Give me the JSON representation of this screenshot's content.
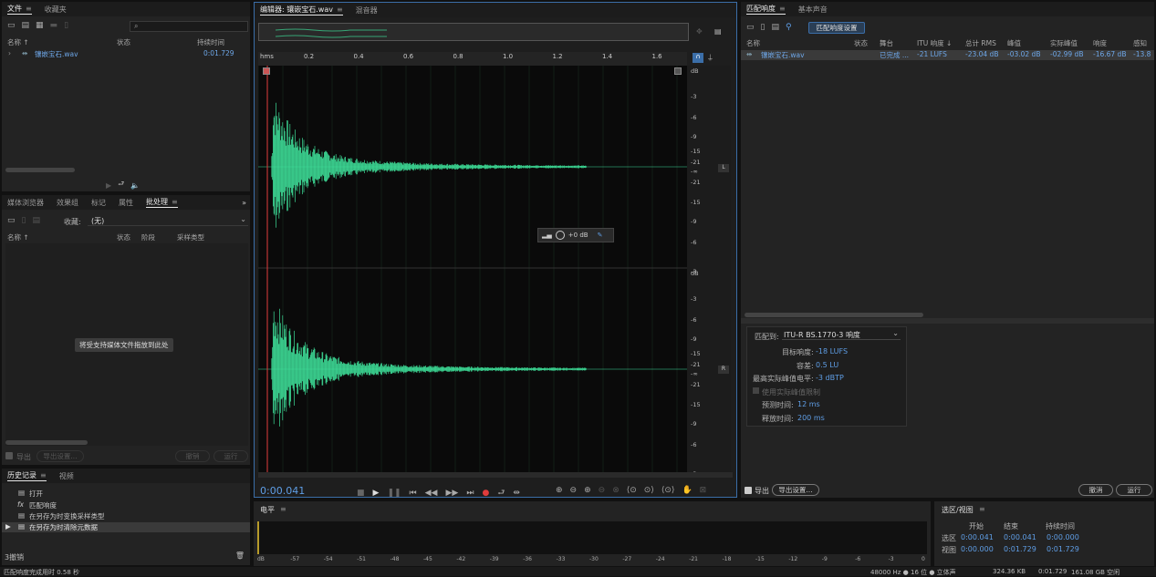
{
  "files_panel": {
    "tabs": [
      "文件",
      "收藏夹"
    ],
    "search_icon": "⌕",
    "col_name": "名称 ↑",
    "col_status": "状态",
    "col_duration": "持续时间",
    "file": {
      "name": "镶嵌宝石.wav",
      "duration": "0:01.729"
    }
  },
  "batch_panel": {
    "tabs": [
      "媒体浏览器",
      "效果组",
      "标记",
      "属性",
      "批处理"
    ],
    "fav_label": "收藏:",
    "fav_value": "(无)",
    "col_name": "名称 ↑",
    "col_status": "状态",
    "col_stage": "阶段",
    "col_sample": "采样类型",
    "drop_hint": "将受支持媒体文件拖放到此处",
    "export_label": "导出",
    "export_settings": "导出设置...",
    "undo": "撤销",
    "run": "运行"
  },
  "history_panel": {
    "tabs": [
      "历史记录",
      "视频"
    ],
    "items": [
      "打开",
      "匹配响度",
      "在另存为时变换采样类型",
      "在另存为时清除元数据"
    ],
    "count": "3撤销"
  },
  "editor": {
    "tabs": [
      "编辑器: 镶嵌宝石.wav",
      "混音器"
    ],
    "ruler_unit": "hms",
    "ruler": [
      "0.2",
      "0.4",
      "0.6",
      "0.8",
      "1.0",
      "1.2",
      "1.4",
      "1.6"
    ],
    "db_ticks": [
      "dB",
      "-3",
      "-6",
      "-9",
      "-15",
      "-21",
      "-∞",
      "-21",
      "-15",
      "-9",
      "-6",
      "-3"
    ],
    "ch_L": "L",
    "ch_R": "R",
    "time": "0:00.041",
    "hud_db": "+0 dB"
  },
  "loudness": {
    "tabs": [
      "匹配响度",
      "基本声音"
    ],
    "settings_btn": "匹配响度设置",
    "cols": [
      "名称",
      "状态",
      "舞台",
      "ITU 响度 ↓",
      "总计 RMS",
      "峰值",
      "实际峰值",
      "响度",
      "感知"
    ],
    "row": {
      "name": "镶嵌宝石.wav",
      "stage": "已完成 ...",
      "itu": "-21 LUFS",
      "rms": "-23.04 dB",
      "peak": "-03.02 dB",
      "true_peak": "-02.99 dB",
      "loud": "-16.67 dB",
      "perc": "-13.8"
    },
    "match_label": "匹配到:",
    "match_value": "ITU-R BS.1770-3 响度",
    "target_label": "目标响度:",
    "target_value": "-18 LUFS",
    "tol_label": "容差:",
    "tol_value": "0.5 LU",
    "max_label": "最高实际峰值电平:",
    "max_value": "-3 dBTP",
    "limit_label": "使用实际峰值限制",
    "look_label": "预测时间:",
    "look_value": "12 ms",
    "rel_label": "释放时间:",
    "rel_value": "200 ms",
    "export_label": "导出",
    "export_settings": "导出设置...",
    "undo": "撤消",
    "run": "运行"
  },
  "level": {
    "title": "电平",
    "ticks": [
      "dB",
      "-57",
      "-54",
      "-51",
      "-48",
      "-45",
      "-42",
      "-39",
      "-36",
      "-33",
      "-30",
      "-27",
      "-24",
      "-21",
      "-18",
      "-15",
      "-12",
      "-9",
      "-6",
      "-3",
      "0"
    ]
  },
  "selection": {
    "title": "选区/视图",
    "col_start": "开始",
    "col_end": "结束",
    "col_dur": "持续时间",
    "sel_label": "选区",
    "sel": [
      "0:00.041",
      "0:00.041",
      "0:00.000"
    ],
    "view_label": "视图",
    "view": [
      "0:00.000",
      "0:01.729",
      "0:01.729"
    ]
  },
  "status": {
    "left": "匹配响度完成用时 0.58 秒",
    "format": "48000 Hz ● 16 位 ● 立体声",
    "size": "324.36 KB",
    "dur": "0:01.729",
    "free": "161.08 GB 空闲"
  },
  "colors": {
    "accent": "#5f9ee6",
    "wave": "#3ddc97",
    "playhead": "#e03c3c"
  }
}
